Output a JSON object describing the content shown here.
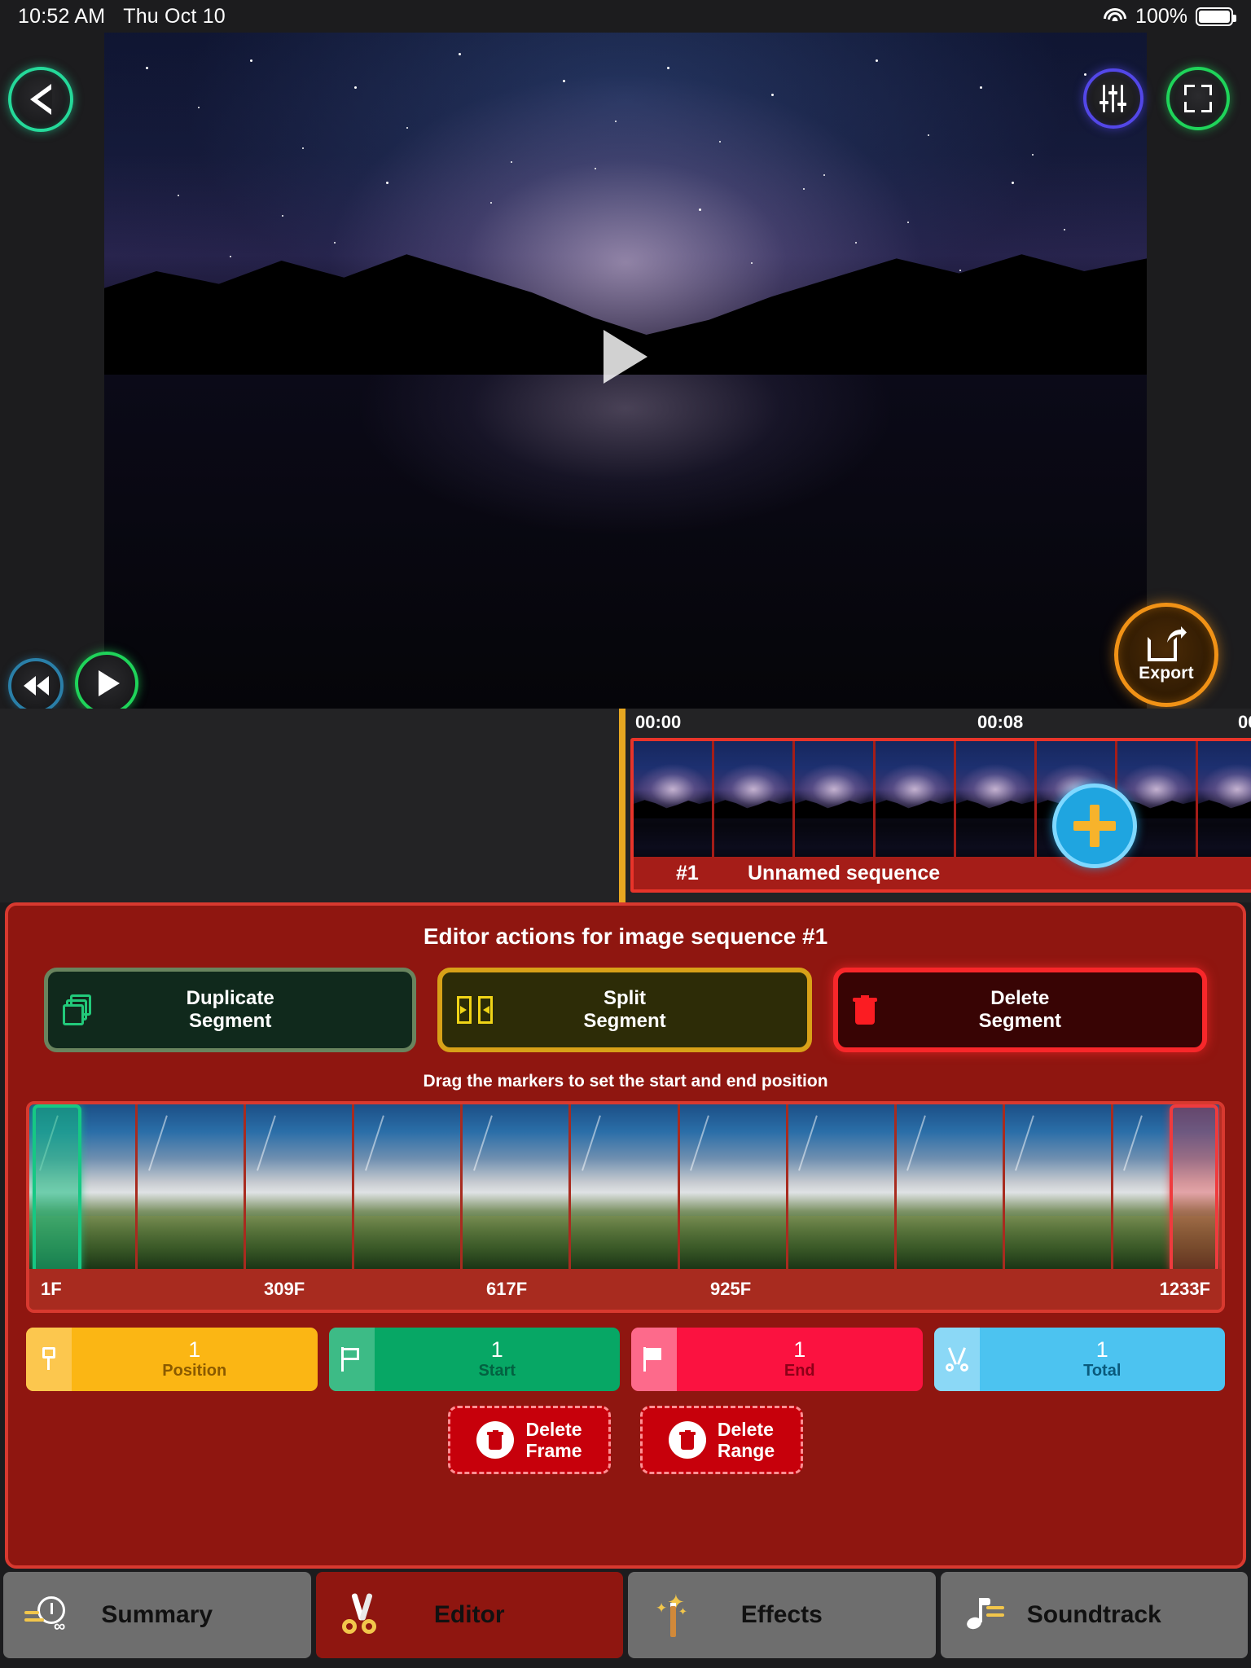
{
  "status_bar": {
    "time": "10:52 AM",
    "date": "Thu Oct 10",
    "battery_percent": "100%",
    "wifi_icon": "wifi-icon",
    "battery_icon": "battery-full-icon"
  },
  "preview": {
    "back_icon": "chevron-left-icon",
    "settings_icon": "sliders-icon",
    "fullscreen_icon": "expand-icon",
    "play_overlay_icon": "play-triangle-icon",
    "rewind_icon": "rewind-icon",
    "play_icon": "play-icon",
    "export_label": "Export",
    "export_icon": "share-export-icon"
  },
  "timeline": {
    "ruler_marks": [
      "00:00",
      "00:08",
      "00"
    ],
    "sequence_number": "#1",
    "sequence_name": "Unnamed sequence",
    "add_icon": "plus-icon"
  },
  "editor": {
    "title": "Editor actions for image sequence #1",
    "actions": [
      {
        "label_line1": "Duplicate",
        "label_line2": "Segment",
        "icon": "duplicate-icon",
        "accent": "#69845e"
      },
      {
        "label_line1": "Split",
        "label_line2": "Segment",
        "icon": "split-icon",
        "accent": "#d8a118"
      },
      {
        "label_line1": "Delete",
        "label_line2": "Segment",
        "icon": "trash-icon",
        "accent": "#f8272a"
      }
    ],
    "hint": "Drag the markers to set the start and end position",
    "frame_ticks": [
      "1F",
      "309F",
      "617F",
      "925F",
      "1233F"
    ],
    "stats": [
      {
        "value": "1",
        "label": "Position",
        "icon": "pin-icon",
        "color": "#fbb614"
      },
      {
        "value": "1",
        "label": "Start",
        "icon": "flag-icon",
        "color": "#07a765"
      },
      {
        "value": "1",
        "label": "End",
        "icon": "flag-solid-icon",
        "color": "#fb1240"
      },
      {
        "value": "1",
        "label": "Total",
        "icon": "scissors-icon",
        "color": "#4cc3f0"
      }
    ],
    "delete_buttons": [
      {
        "line1": "Delete",
        "line2": "Frame",
        "icon": "trash-circle-icon"
      },
      {
        "line1": "Delete",
        "line2": "Range",
        "icon": "trash-circle-icon"
      }
    ]
  },
  "tabs": [
    {
      "label": "Summary",
      "icon": "clock-history-icon",
      "active": false
    },
    {
      "label": "Editor",
      "icon": "scissors-icon",
      "active": true
    },
    {
      "label": "Effects",
      "icon": "magic-wand-icon",
      "active": false
    },
    {
      "label": "Soundtrack",
      "icon": "music-note-icon",
      "active": false
    }
  ]
}
